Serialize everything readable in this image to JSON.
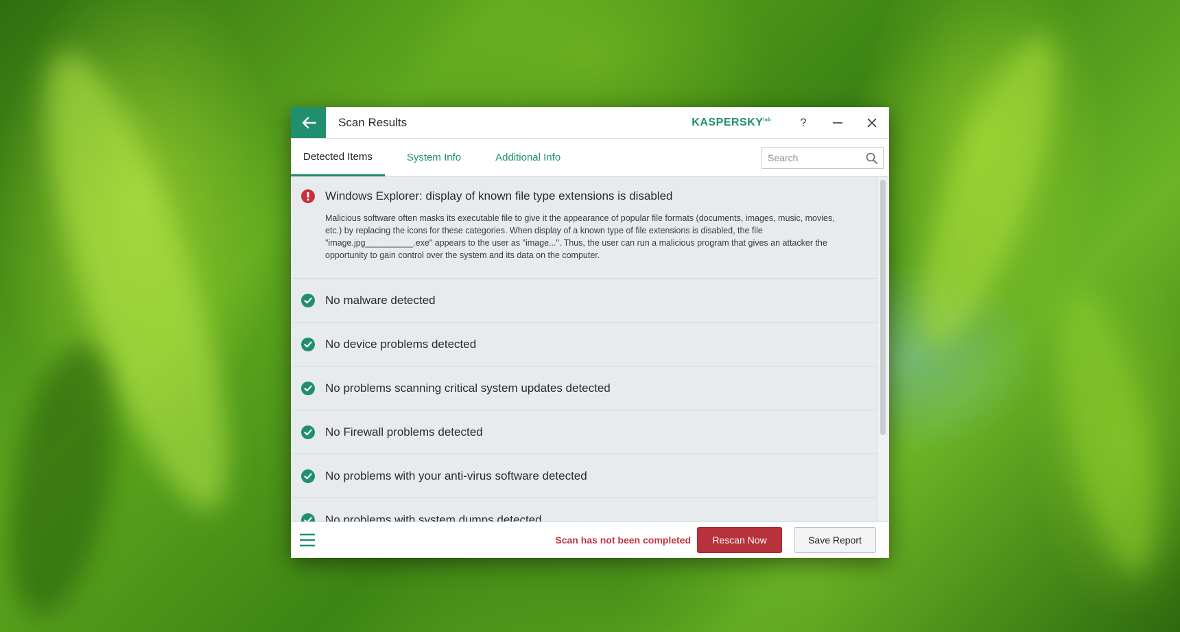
{
  "window": {
    "title": "Scan Results",
    "brand": "KASPERSKY",
    "brand_sup": "lab",
    "help_label": "?"
  },
  "tabs": [
    {
      "label": "Detected Items",
      "active": true
    },
    {
      "label": "System Info",
      "active": false
    },
    {
      "label": "Additional Info",
      "active": false
    }
  ],
  "search": {
    "placeholder": "Search",
    "value": ""
  },
  "items": [
    {
      "status": "warning",
      "icon": "exclamation-circle-icon",
      "title": "Windows Explorer: display of known file type extensions is disabled",
      "description": "Malicious software often masks its executable file to give it the appearance of popular file formats (documents, images, music, movies, etc.) by replacing the icons for these categories. When display of a known type of file extensions is disabled, the file \"image.jpg__________.exe\" appears to the user as \"image...\". Thus, the user can run a malicious program that gives an attacker the opportunity to gain control over the system and its data on the computer."
    },
    {
      "status": "ok",
      "icon": "check-circle-icon",
      "title": "No malware detected"
    },
    {
      "status": "ok",
      "icon": "check-circle-icon",
      "title": "No device problems detected"
    },
    {
      "status": "ok",
      "icon": "check-circle-icon",
      "title": "No problems scanning critical system updates detected"
    },
    {
      "status": "ok",
      "icon": "check-circle-icon",
      "title": "No Firewall problems detected"
    },
    {
      "status": "ok",
      "icon": "check-circle-icon",
      "title": "No problems with your anti-virus software detected"
    },
    {
      "status": "ok",
      "icon": "check-circle-icon",
      "title": "No problems with system dumps detected"
    }
  ],
  "footer": {
    "status_text": "Scan has not been completed",
    "rescan_label": "Rescan Now",
    "save_label": "Save Report"
  },
  "colors": {
    "accent": "#1f8f6f",
    "warning": "#c0353f",
    "rescan_button": "#b8323c",
    "list_background": "#e7ebee"
  }
}
